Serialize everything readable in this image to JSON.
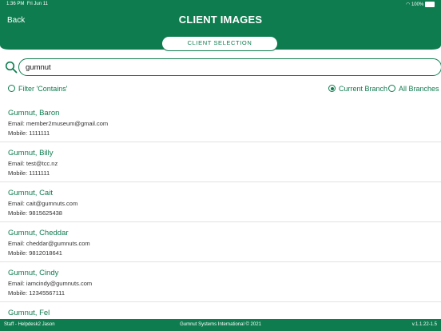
{
  "status_bar": {
    "time": "1:36 PM",
    "date": "Fri Jun 11",
    "battery": "100%"
  },
  "header": {
    "back_label": "Back",
    "title": "CLIENT IMAGES"
  },
  "selection_tab": {
    "label": "CLIENT SELECTION"
  },
  "search": {
    "value": "gumnut",
    "icon": "search-icon"
  },
  "filters": {
    "contains_label": "Filter 'Contains'",
    "current_branch_label": "Current Branch",
    "all_branches_label": "All Branches",
    "selected": "Current Branch"
  },
  "clients": [
    {
      "name": "Gumnut, Baron",
      "email": "Email: member2museum@gmail.com",
      "mobile": "Mobile: 1111111"
    },
    {
      "name": "Gumnut, Billy",
      "email": "Email: test@tcc.nz",
      "mobile": "Mobile: 1111111"
    },
    {
      "name": "Gumnut, Cait",
      "email": "Email: cait@gumnuts.com",
      "mobile": "Mobile: 9815625438"
    },
    {
      "name": "Gumnut, Cheddar",
      "email": "Email: cheddar@gumnuts.com",
      "mobile": "Mobile: 9812018641"
    },
    {
      "name": "Gumnut, Cindy",
      "email": "Email: iamcindy@gumnuts.com",
      "mobile": "Mobile: 12345567111"
    },
    {
      "name": "Gumnut, Fel",
      "email": "",
      "mobile": ""
    }
  ],
  "footer": {
    "user": "Staff - Helpdesk2 Jason",
    "copyright": "Gumnut Systems International © 2021",
    "version": "v.1.1.22-1.5"
  },
  "colors": {
    "brand": "#0e7c4e"
  }
}
